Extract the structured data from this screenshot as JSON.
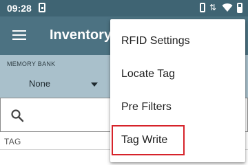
{
  "status_bar": {
    "time": "09:28",
    "icons": [
      "sim-icon",
      "vibrate-icon",
      "data-icon",
      "wifi-icon",
      "battery-icon"
    ]
  },
  "app_bar": {
    "title": "Inventory"
  },
  "memory_bank": {
    "label": "MEMORY BANK",
    "selected": "None"
  },
  "search": {
    "placeholder": ""
  },
  "table": {
    "columns": [
      "TAG"
    ]
  },
  "overflow_menu": {
    "items": [
      {
        "label": "RFID Settings"
      },
      {
        "label": "Locate Tag"
      },
      {
        "label": "Pre Filters"
      },
      {
        "label": "Tag Write",
        "highlighted": true
      }
    ]
  },
  "colors": {
    "status_bar": "#3f6473",
    "app_bar": "#4c7282",
    "filter_strip": "#a9c0cb",
    "highlight": "#d6232a"
  }
}
